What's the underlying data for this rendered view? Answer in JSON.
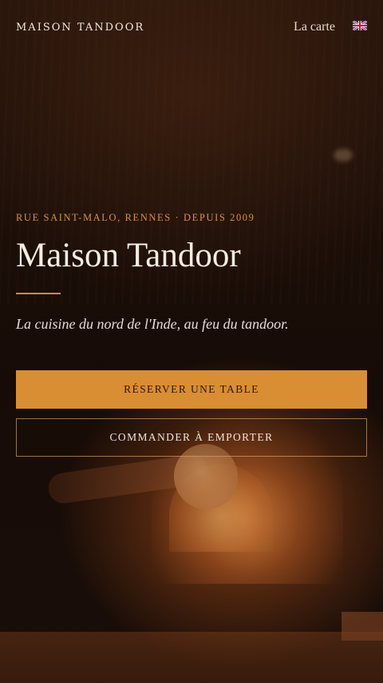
{
  "header": {
    "brand": "MAISON TANDOOR",
    "nav_link": "La carte",
    "language_icon": "uk-flag-icon"
  },
  "hero": {
    "kicker": "RUE SAINT-MALO, RENNES · DEPUIS 2009",
    "title": "Maison Tandoor",
    "tagline": "La cuisine du nord de l'Inde, au feu du tandoor.",
    "primary_button": "RÉSERVER UNE TABLE",
    "secondary_button": "COMMANDER À EMPORTER"
  },
  "colors": {
    "accent": "#d98e34",
    "kicker": "#d5924c",
    "background": "#1a0e08",
    "text": "#f3e9dc"
  }
}
